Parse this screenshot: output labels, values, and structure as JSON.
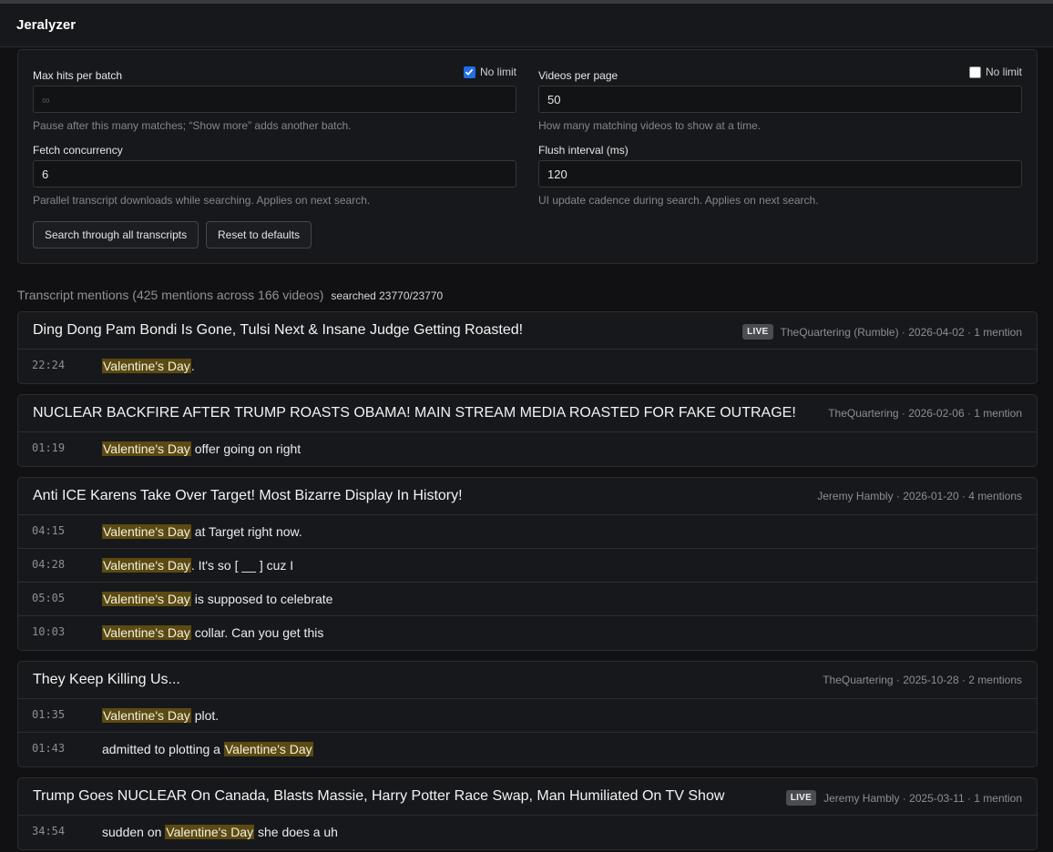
{
  "app": {
    "title": "Jeralyzer"
  },
  "settings": {
    "max_hits": {
      "label": "Max hits per batch",
      "no_limit_label": "No limit",
      "no_limit_checked": true,
      "placeholder": "∞",
      "value": "",
      "hint": "Pause after this many matches; “Show more” adds another batch."
    },
    "videos_per_page": {
      "label": "Videos per page",
      "no_limit_label": "No limit",
      "no_limit_checked": false,
      "value": "50",
      "hint": "How many matching videos to show at a time."
    },
    "fetch_concurrency": {
      "label": "Fetch concurrency",
      "value": "6",
      "hint": "Parallel transcript downloads while searching. Applies on next search."
    },
    "flush_interval": {
      "label": "Flush interval (ms)",
      "value": "120",
      "hint": "UI update cadence during search. Applies on next search."
    },
    "buttons": {
      "search_all": "Search through all transcripts",
      "reset": "Reset to defaults"
    }
  },
  "summary": {
    "text": "Transcript mentions (425 mentions across 166 videos)",
    "searched": "searched 23770/23770"
  },
  "highlight_term": "Valentine's Day",
  "results": [
    {
      "title": "Ding Dong Pam Bondi Is Gone, Tulsi Next & Insane Judge Getting Roasted!",
      "live": true,
      "live_label": "LIVE",
      "meta": "TheQuartering (Rumble) · 2026-04-02 · 1 mention",
      "mentions": [
        {
          "ts": "22:24",
          "before": "",
          "match": "Valentine's Day",
          "after": "."
        }
      ]
    },
    {
      "title": "NUCLEAR BACKFIRE AFTER TRUMP ROASTS OBAMA! MAIN STREAM MEDIA ROASTED FOR FAKE OUTRAGE!",
      "live": false,
      "live_label": "",
      "meta": "TheQuartering · 2026-02-06 · 1 mention",
      "mentions": [
        {
          "ts": "01:19",
          "before": "",
          "match": "Valentine's Day",
          "after": " offer going on right"
        }
      ]
    },
    {
      "title": "Anti ICE Karens Take Over Target! Most Bizarre Display In History!",
      "live": false,
      "live_label": "",
      "meta": "Jeremy Hambly · 2026-01-20 · 4 mentions",
      "mentions": [
        {
          "ts": "04:15",
          "before": "",
          "match": "Valentine's Day",
          "after": " at Target right now."
        },
        {
          "ts": "04:28",
          "before": "",
          "match": "Valentine's Day",
          "after": ". It's so [ __ ] cuz I"
        },
        {
          "ts": "05:05",
          "before": "",
          "match": "Valentine's Day",
          "after": " is supposed to celebrate"
        },
        {
          "ts": "10:03",
          "before": "",
          "match": "Valentine's Day",
          "after": " collar. Can you get this"
        }
      ]
    },
    {
      "title": "They Keep Killing Us...",
      "live": false,
      "live_label": "",
      "meta": "TheQuartering · 2025-10-28 · 2 mentions",
      "mentions": [
        {
          "ts": "01:35",
          "before": "",
          "match": "Valentine's Day",
          "after": " plot."
        },
        {
          "ts": "01:43",
          "before": "admitted to plotting a ",
          "match": "Valentine's Day",
          "after": ""
        }
      ]
    },
    {
      "title": "Trump Goes NUCLEAR On Canada, Blasts Massie, Harry Potter Race Swap, Man Humiliated On TV Show",
      "live": true,
      "live_label": "LIVE",
      "meta": "Jeremy Hambly · 2025-03-11 · 1 mention",
      "mentions": [
        {
          "ts": "34:54",
          "before": "sudden on ",
          "match": "Valentine's Day",
          "after": " she does a uh"
        }
      ]
    }
  ]
}
